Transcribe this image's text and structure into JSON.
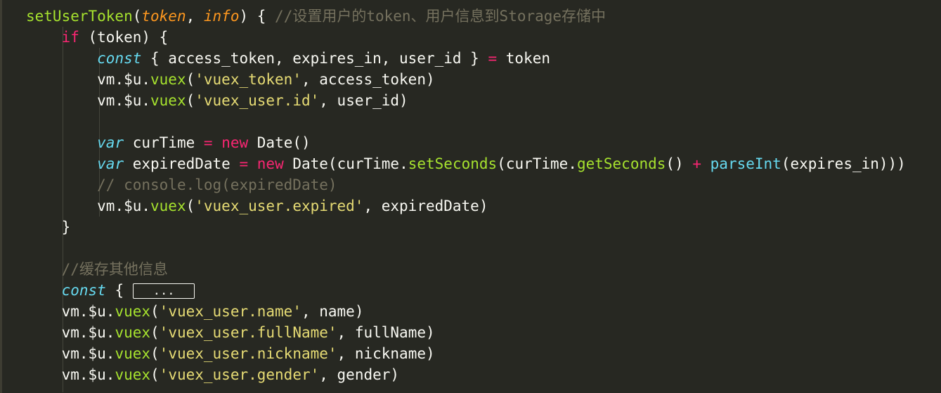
{
  "editor": {
    "theme_colors": {
      "background": "#272822",
      "function": "#a6e22e",
      "parameter": "#fd971f",
      "keyword": "#f92672",
      "storage": "#66d9ef",
      "string": "#e6db74",
      "comment": "#75715e",
      "text": "#f8f8f2"
    },
    "lines": [
      {
        "indent": 0,
        "tokens": [
          {
            "t": "fn",
            "v": "setUserToken"
          },
          {
            "t": "plain",
            "v": "("
          },
          {
            "t": "param",
            "v": "token"
          },
          {
            "t": "plain",
            "v": ", "
          },
          {
            "t": "param",
            "v": "info"
          },
          {
            "t": "plain",
            "v": ") { "
          },
          {
            "t": "cm",
            "v": "//设置用户的token、用户信息到Storage存储中"
          }
        ]
      },
      {
        "indent": 1,
        "tokens": [
          {
            "t": "kw",
            "v": "if"
          },
          {
            "t": "plain",
            "v": " (token) {"
          }
        ]
      },
      {
        "indent": 2,
        "tokens": [
          {
            "t": "st",
            "v": "const"
          },
          {
            "t": "plain",
            "v": " { access_token, expires_in, user_id } "
          },
          {
            "t": "op",
            "v": "="
          },
          {
            "t": "plain",
            "v": " token"
          }
        ]
      },
      {
        "indent": 2,
        "tokens": [
          {
            "t": "plain",
            "v": "vm.$u."
          },
          {
            "t": "fn",
            "v": "vuex"
          },
          {
            "t": "plain",
            "v": "("
          },
          {
            "t": "str",
            "v": "'vuex_token'"
          },
          {
            "t": "plain",
            "v": ", access_token)"
          }
        ]
      },
      {
        "indent": 2,
        "tokens": [
          {
            "t": "plain",
            "v": "vm.$u."
          },
          {
            "t": "fn",
            "v": "vuex"
          },
          {
            "t": "plain",
            "v": "("
          },
          {
            "t": "str",
            "v": "'vuex_user.id'"
          },
          {
            "t": "plain",
            "v": ", user_id)"
          }
        ]
      },
      {
        "indent": 0,
        "tokens": []
      },
      {
        "indent": 2,
        "tokens": [
          {
            "t": "st",
            "v": "var"
          },
          {
            "t": "plain",
            "v": " curTime "
          },
          {
            "t": "op",
            "v": "="
          },
          {
            "t": "plain",
            "v": " "
          },
          {
            "t": "kw",
            "v": "new"
          },
          {
            "t": "plain",
            "v": " Date()"
          }
        ]
      },
      {
        "indent": 2,
        "tokens": [
          {
            "t": "st",
            "v": "var"
          },
          {
            "t": "plain",
            "v": " expiredDate "
          },
          {
            "t": "op",
            "v": "="
          },
          {
            "t": "plain",
            "v": " "
          },
          {
            "t": "kw",
            "v": "new"
          },
          {
            "t": "plain",
            "v": " Date(curTime."
          },
          {
            "t": "fn",
            "v": "setSeconds"
          },
          {
            "t": "plain",
            "v": "(curTime."
          },
          {
            "t": "fn",
            "v": "getSeconds"
          },
          {
            "t": "plain",
            "v": "() "
          },
          {
            "t": "op",
            "v": "+"
          },
          {
            "t": "plain",
            "v": " "
          },
          {
            "t": "bi",
            "v": "parseInt"
          },
          {
            "t": "plain",
            "v": "(expires_in)))"
          }
        ]
      },
      {
        "indent": 2,
        "tokens": [
          {
            "t": "cm",
            "v": "// console.log(expiredDate)"
          }
        ]
      },
      {
        "indent": 2,
        "tokens": [
          {
            "t": "plain",
            "v": "vm.$u."
          },
          {
            "t": "fn",
            "v": "vuex"
          },
          {
            "t": "plain",
            "v": "("
          },
          {
            "t": "str",
            "v": "'vuex_user.expired'"
          },
          {
            "t": "plain",
            "v": ", expiredDate)"
          }
        ]
      },
      {
        "indent": 1,
        "tokens": [
          {
            "t": "plain",
            "v": "}"
          }
        ]
      },
      {
        "indent": 0,
        "tokens": []
      },
      {
        "indent": 1,
        "tokens": [
          {
            "t": "cm",
            "v": "//缓存其他信息"
          }
        ]
      },
      {
        "indent": 1,
        "tokens": [
          {
            "t": "st",
            "v": "const"
          },
          {
            "t": "plain",
            "v": " { "
          },
          {
            "t": "fold",
            "v": "..."
          }
        ]
      },
      {
        "indent": 1,
        "tokens": [
          {
            "t": "plain",
            "v": "vm.$u."
          },
          {
            "t": "fn",
            "v": "vuex"
          },
          {
            "t": "plain",
            "v": "("
          },
          {
            "t": "str",
            "v": "'vuex_user.name'"
          },
          {
            "t": "plain",
            "v": ", name)"
          }
        ]
      },
      {
        "indent": 1,
        "tokens": [
          {
            "t": "plain",
            "v": "vm.$u."
          },
          {
            "t": "fn",
            "v": "vuex"
          },
          {
            "t": "plain",
            "v": "("
          },
          {
            "t": "str",
            "v": "'vuex_user.fullName'"
          },
          {
            "t": "plain",
            "v": ", fullName)"
          }
        ]
      },
      {
        "indent": 1,
        "tokens": [
          {
            "t": "plain",
            "v": "vm.$u."
          },
          {
            "t": "fn",
            "v": "vuex"
          },
          {
            "t": "plain",
            "v": "("
          },
          {
            "t": "str",
            "v": "'vuex_user.nickname'"
          },
          {
            "t": "plain",
            "v": ", nickname)"
          }
        ]
      },
      {
        "indent": 1,
        "tokens": [
          {
            "t": "plain",
            "v": "vm.$u."
          },
          {
            "t": "fn",
            "v": "vuex"
          },
          {
            "t": "plain",
            "v": "("
          },
          {
            "t": "str",
            "v": "'vuex_user.gender'"
          },
          {
            "t": "plain",
            "v": ", gender)"
          }
        ]
      }
    ]
  }
}
